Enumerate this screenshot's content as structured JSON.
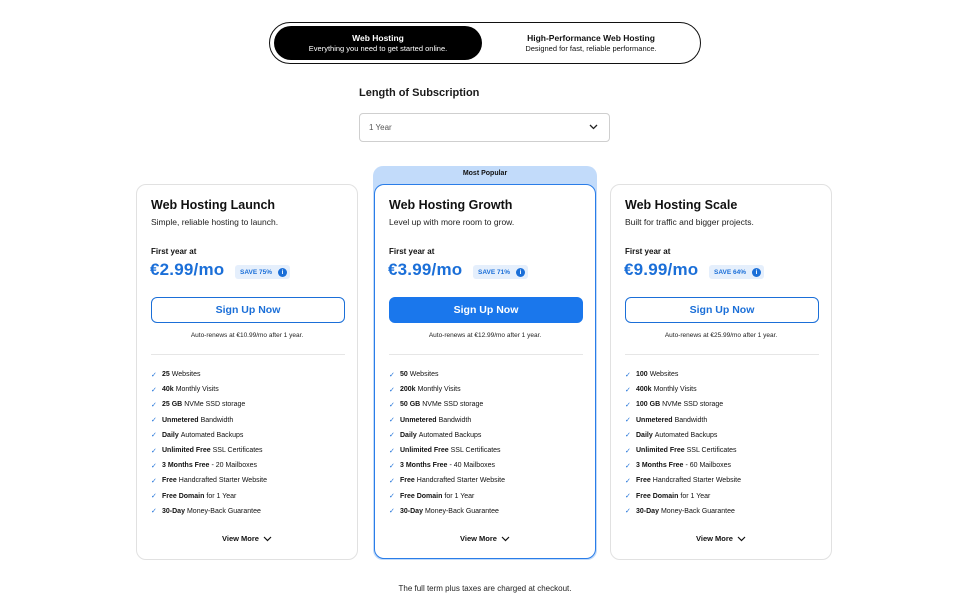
{
  "toggle": {
    "options": [
      {
        "title": "Web Hosting",
        "subtitle": "Everything you need to get started online."
      },
      {
        "title": "High-Performance Web Hosting",
        "subtitle": "Designed for fast, reliable performance."
      }
    ],
    "active_index": 0
  },
  "subscription": {
    "label": "Length of Subscription",
    "selected": "1 Year"
  },
  "popular_badge": "Most Popular",
  "colors": {
    "accent": "#1b6fd8",
    "popular_bg": "#c2dbfa"
  },
  "plans": [
    {
      "title": "Web Hosting Launch",
      "description": "Simple, reliable hosting to launch.",
      "first_year_label": "First year at",
      "price": "€2.99/mo",
      "save": "SAVE 75%",
      "button": "Sign Up Now",
      "renew": "Auto-renews at €10.99/mo after 1 year.",
      "features": [
        {
          "bold": "25",
          "rest": "Websites"
        },
        {
          "bold": "40k",
          "rest": "Monthly Visits"
        },
        {
          "bold": "25 GB",
          "rest": "NVMe SSD storage"
        },
        {
          "bold": "Unmetered",
          "rest": "Bandwidth"
        },
        {
          "bold": "Daily",
          "rest": "Automated Backups"
        },
        {
          "bold": "Unlimited Free",
          "rest": "SSL Certificates"
        },
        {
          "bold": "3 Months Free",
          "rest": "- 20 Mailboxes"
        },
        {
          "bold": "Free",
          "rest": "Handcrafted Starter Website"
        },
        {
          "bold": "Free Domain",
          "rest": "for 1 Year"
        },
        {
          "bold": "30-Day",
          "rest": "Money-Back Guarantee"
        }
      ],
      "view_more": "View More"
    },
    {
      "title": "Web Hosting Growth",
      "description": "Level up with more room to grow.",
      "first_year_label": "First year at",
      "price": "€3.99/mo",
      "save": "SAVE 71%",
      "button": "Sign Up Now",
      "renew": "Auto-renews at €12.99/mo after 1 year.",
      "features": [
        {
          "bold": "50",
          "rest": "Websites"
        },
        {
          "bold": "200k",
          "rest": "Monthly Visits"
        },
        {
          "bold": "50 GB",
          "rest": "NVMe SSD storage"
        },
        {
          "bold": "Unmetered",
          "rest": "Bandwidth"
        },
        {
          "bold": "Daily",
          "rest": "Automated Backups"
        },
        {
          "bold": "Unlimited Free",
          "rest": "SSL Certificates"
        },
        {
          "bold": "3 Months Free",
          "rest": "- 40 Mailboxes"
        },
        {
          "bold": "Free",
          "rest": "Handcrafted Starter Website"
        },
        {
          "bold": "Free Domain",
          "rest": "for 1 Year"
        },
        {
          "bold": "30-Day",
          "rest": "Money-Back Guarantee"
        }
      ],
      "view_more": "View More"
    },
    {
      "title": "Web Hosting Scale",
      "description": "Built for traffic and bigger projects.",
      "first_year_label": "First year at",
      "price": "€9.99/mo",
      "save": "SAVE 64%",
      "button": "Sign Up Now",
      "renew": "Auto-renews at €25.99/mo after 1 year.",
      "features": [
        {
          "bold": "100",
          "rest": "Websites"
        },
        {
          "bold": "400k",
          "rest": "Monthly Visits"
        },
        {
          "bold": "100 GB",
          "rest": "NVMe SSD storage"
        },
        {
          "bold": "Unmetered",
          "rest": "Bandwidth"
        },
        {
          "bold": "Daily",
          "rest": "Automated Backups"
        },
        {
          "bold": "Unlimited Free",
          "rest": "SSL Certificates"
        },
        {
          "bold": "3 Months Free",
          "rest": "- 60 Mailboxes"
        },
        {
          "bold": "Free",
          "rest": "Handcrafted Starter Website"
        },
        {
          "bold": "Free Domain",
          "rest": "for 1 Year"
        },
        {
          "bold": "30-Day",
          "rest": "Money-Back Guarantee"
        }
      ],
      "view_more": "View More"
    }
  ],
  "footnote": "The full term plus taxes are charged at checkout."
}
